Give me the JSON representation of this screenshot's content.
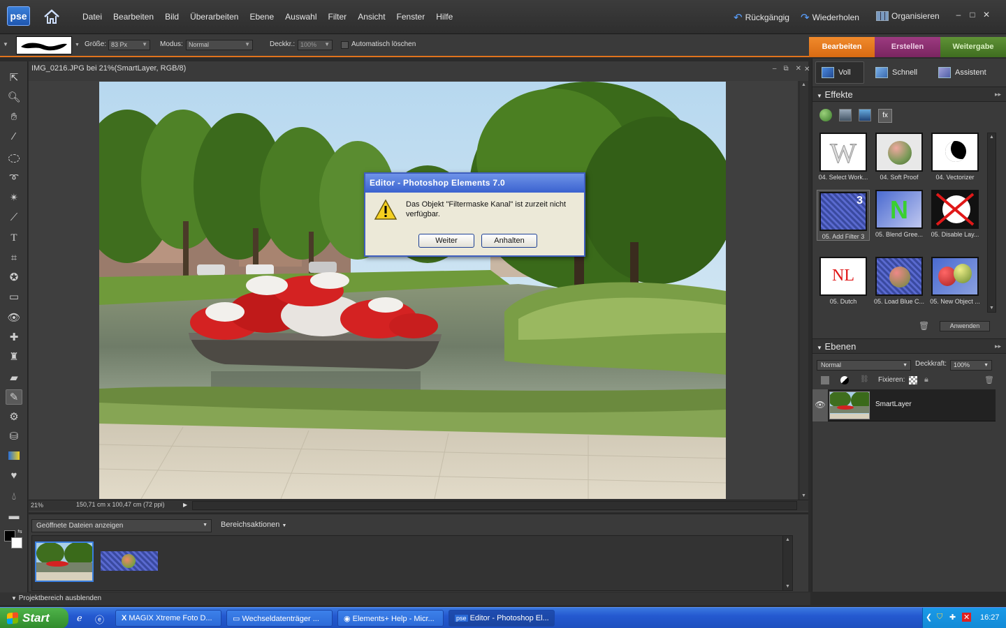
{
  "app": {
    "logo": "pse",
    "menus": [
      "Datei",
      "Bearbeiten",
      "Bild",
      "Überarbeiten",
      "Ebene",
      "Auswahl",
      "Filter",
      "Ansicht",
      "Fenster",
      "Hilfe"
    ],
    "undo_label": "Rückgängig",
    "redo_label": "Wiederholen",
    "organize_label": "Organisieren"
  },
  "options": {
    "size_label": "Größe:",
    "size_value": "83 Px",
    "mode_label": "Modus:",
    "mode_value": "Normal",
    "opacity_label": "Deckkr.:",
    "opacity_value": "100%",
    "auto_erase_label": "Automatisch löschen"
  },
  "mode_tabs": [
    {
      "label": "Bearbeiten",
      "color": "#e0731c"
    },
    {
      "label": "Erstellen",
      "color": "#8a2a6e"
    },
    {
      "label": "Weitergabe",
      "color": "#4f7f2a"
    }
  ],
  "document": {
    "title": "IMG_0216.JPG bei 21%(SmartLayer, RGB/8)",
    "zoom": "21%",
    "dimensions": "150,71 cm x 100,47 cm (72 ppi)"
  },
  "project_bin": {
    "dropdown": "Geöffnete Dateien anzeigen",
    "actions": "Bereichsaktionen",
    "toggle": "Projektbereich ausblenden"
  },
  "palette": {
    "views": [
      "Voll",
      "Schnell",
      "Assistent"
    ],
    "effects_title": "Effekte",
    "effects": [
      "04. Select Work...",
      "04. Soft Proof",
      "04. Vectorizer",
      "05. Add Filter 3",
      "05. Blend Gree...",
      "05. Disable Lay...",
      "05. Dutch",
      "05. Load Blue C...",
      "05. New Object ..."
    ],
    "apply_label": "Anwenden",
    "layers_title": "Ebenen",
    "blend_mode": "Normal",
    "opacity_label": "Deckkraft:",
    "opacity_value": "100%",
    "lock_label": "Fixieren:",
    "layer_name": "SmartLayer"
  },
  "dialog": {
    "title": "Editor - Photoshop Elements 7.0",
    "message": "Das Objekt \"Filtermaske Kanal\" ist zurzeit nicht verfügbar.",
    "continue_label": "Weiter",
    "stop_label": "Anhalten"
  },
  "taskbar": {
    "start_label": "Start",
    "tasks": [
      "MAGIX Xtreme Foto D...",
      "Wechseldatenträger ...",
      "Elements+ Help - Micr...",
      "Editor - Photoshop El..."
    ],
    "clock": "16:27"
  }
}
